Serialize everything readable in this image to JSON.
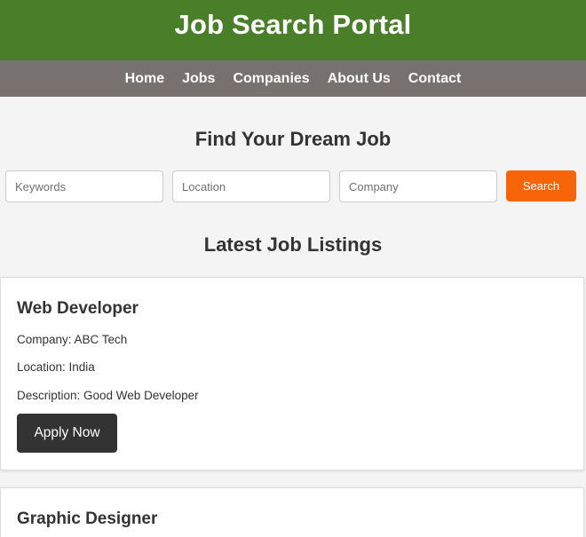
{
  "header": {
    "title": "Job Search Portal"
  },
  "nav": {
    "items": [
      {
        "label": "Home"
      },
      {
        "label": "Jobs"
      },
      {
        "label": "Companies"
      },
      {
        "label": "About Us"
      },
      {
        "label": "Contact"
      }
    ]
  },
  "search": {
    "title": "Find Your Dream Job",
    "keywords_placeholder": "Keywords",
    "location_placeholder": "Location",
    "company_placeholder": "Company",
    "button_label": "Search"
  },
  "listings": {
    "title": "Latest Job Listings",
    "jobs": [
      {
        "title": "Web Developer",
        "company": "Company: ABC Tech",
        "location": "Location: India",
        "description": "Description: Good Web Developer",
        "apply_label": "Apply Now"
      },
      {
        "title": "Graphic Designer"
      }
    ]
  },
  "colors": {
    "header_bg": "#4a7f2a",
    "nav_bg": "#777270",
    "search_button": "#f76508",
    "apply_button": "#333333"
  }
}
